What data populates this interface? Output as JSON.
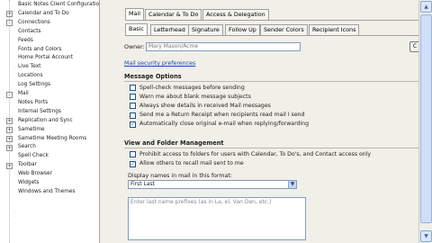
{
  "tree": {
    "items": [
      {
        "label": "Basic Notes Client Configuratio",
        "exp": "",
        "indent": 1
      },
      {
        "label": "Calendar and To Do",
        "exp": "+",
        "indent": 0
      },
      {
        "label": "Connections",
        "exp": "-",
        "indent": 0
      },
      {
        "label": "Contacts",
        "exp": "",
        "indent": 1
      },
      {
        "label": "Feeds",
        "exp": "",
        "indent": 1
      },
      {
        "label": "Fonts and Colors",
        "exp": "",
        "indent": 1
      },
      {
        "label": "Home Portal Account",
        "exp": "",
        "indent": 1
      },
      {
        "label": "Live Text",
        "exp": "",
        "indent": 1
      },
      {
        "label": "Locations",
        "exp": "",
        "indent": 1
      },
      {
        "label": "Log Settings",
        "exp": "",
        "indent": 1
      },
      {
        "label": "Mail",
        "exp": "-",
        "indent": 0
      },
      {
        "label": "Notes Ports",
        "exp": "",
        "indent": 1
      },
      {
        "label": "Internal Settings",
        "exp": "",
        "indent": 1
      },
      {
        "label": "Replication and Sync",
        "exp": "+",
        "indent": 0
      },
      {
        "label": "Sametime",
        "exp": "+",
        "indent": 0
      },
      {
        "label": "Sametime Meeting Rooms",
        "exp": "+",
        "indent": 0
      },
      {
        "label": "Search",
        "exp": "+",
        "indent": 0
      },
      {
        "label": "Spell Check",
        "exp": "",
        "indent": 1
      },
      {
        "label": "Toolbar",
        "exp": "+",
        "indent": 0
      },
      {
        "label": "Web Browser",
        "exp": "",
        "indent": 1
      },
      {
        "label": "Widgets",
        "exp": "",
        "indent": 1
      },
      {
        "label": "Windows and Themes",
        "exp": "",
        "indent": 1
      }
    ]
  },
  "top_tabs": [
    "Mail",
    "Calendar & To Do",
    "Access & Delegation"
  ],
  "sub_tabs": [
    "Basic",
    "Letterhead",
    "Signature",
    "Follow Up",
    "Sender Colors",
    "Recipient Icons"
  ],
  "owner": {
    "label": "Owner:",
    "value": "Mary Mason/Acme"
  },
  "security_link": "Mail security preferences",
  "message_options": {
    "heading": "Message Options",
    "items": [
      {
        "label": "Spell-check messages before sending",
        "checked": false
      },
      {
        "label": "Warn me about blank message subjects",
        "checked": false
      },
      {
        "label": "Always show details in received Mail messages",
        "checked": false
      },
      {
        "label": "Send me a Return Receipt when recipients read mail I send",
        "checked": false
      },
      {
        "label": "Automatically close original e-mail when replying/forwarding",
        "checked": true
      }
    ]
  },
  "view_folder": {
    "heading": "View and Folder Management",
    "items": [
      {
        "label": "Prohibit access to folders for users with Calendar, To Do's, and Contact access only",
        "checked": false
      },
      {
        "label": "Allow others to recall mail sent to me",
        "checked": true
      }
    ],
    "display_label": "Display names in mail in this format:",
    "display_value": "First Last",
    "prefix_label": "Enter last name prefixes (as in La, el, Van Den, etc.)"
  },
  "side_button_label": "C",
  "scroll": {
    "up": "▲",
    "down": "▼"
  }
}
